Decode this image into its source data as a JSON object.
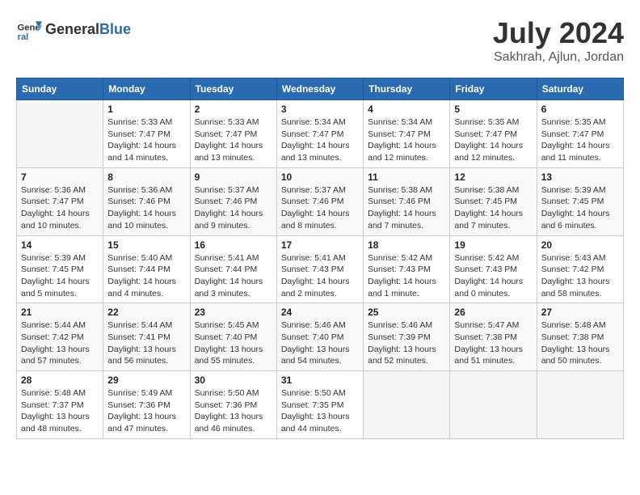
{
  "header": {
    "logo_general": "General",
    "logo_blue": "Blue",
    "month": "July 2024",
    "location": "Sakhrah, Ajlun, Jordan"
  },
  "weekdays": [
    "Sunday",
    "Monday",
    "Tuesday",
    "Wednesday",
    "Thursday",
    "Friday",
    "Saturday"
  ],
  "weeks": [
    [
      {
        "day": "",
        "info": ""
      },
      {
        "day": "1",
        "info": "Sunrise: 5:33 AM\nSunset: 7:47 PM\nDaylight: 14 hours\nand 14 minutes."
      },
      {
        "day": "2",
        "info": "Sunrise: 5:33 AM\nSunset: 7:47 PM\nDaylight: 14 hours\nand 13 minutes."
      },
      {
        "day": "3",
        "info": "Sunrise: 5:34 AM\nSunset: 7:47 PM\nDaylight: 14 hours\nand 13 minutes."
      },
      {
        "day": "4",
        "info": "Sunrise: 5:34 AM\nSunset: 7:47 PM\nDaylight: 14 hours\nand 12 minutes."
      },
      {
        "day": "5",
        "info": "Sunrise: 5:35 AM\nSunset: 7:47 PM\nDaylight: 14 hours\nand 12 minutes."
      },
      {
        "day": "6",
        "info": "Sunrise: 5:35 AM\nSunset: 7:47 PM\nDaylight: 14 hours\nand 11 minutes."
      }
    ],
    [
      {
        "day": "7",
        "info": "Sunrise: 5:36 AM\nSunset: 7:47 PM\nDaylight: 14 hours\nand 10 minutes."
      },
      {
        "day": "8",
        "info": "Sunrise: 5:36 AM\nSunset: 7:46 PM\nDaylight: 14 hours\nand 10 minutes."
      },
      {
        "day": "9",
        "info": "Sunrise: 5:37 AM\nSunset: 7:46 PM\nDaylight: 14 hours\nand 9 minutes."
      },
      {
        "day": "10",
        "info": "Sunrise: 5:37 AM\nSunset: 7:46 PM\nDaylight: 14 hours\nand 8 minutes."
      },
      {
        "day": "11",
        "info": "Sunrise: 5:38 AM\nSunset: 7:46 PM\nDaylight: 14 hours\nand 7 minutes."
      },
      {
        "day": "12",
        "info": "Sunrise: 5:38 AM\nSunset: 7:45 PM\nDaylight: 14 hours\nand 7 minutes."
      },
      {
        "day": "13",
        "info": "Sunrise: 5:39 AM\nSunset: 7:45 PM\nDaylight: 14 hours\nand 6 minutes."
      }
    ],
    [
      {
        "day": "14",
        "info": "Sunrise: 5:39 AM\nSunset: 7:45 PM\nDaylight: 14 hours\nand 5 minutes."
      },
      {
        "day": "15",
        "info": "Sunrise: 5:40 AM\nSunset: 7:44 PM\nDaylight: 14 hours\nand 4 minutes."
      },
      {
        "day": "16",
        "info": "Sunrise: 5:41 AM\nSunset: 7:44 PM\nDaylight: 14 hours\nand 3 minutes."
      },
      {
        "day": "17",
        "info": "Sunrise: 5:41 AM\nSunset: 7:43 PM\nDaylight: 14 hours\nand 2 minutes."
      },
      {
        "day": "18",
        "info": "Sunrise: 5:42 AM\nSunset: 7:43 PM\nDaylight: 14 hours\nand 1 minute."
      },
      {
        "day": "19",
        "info": "Sunrise: 5:42 AM\nSunset: 7:43 PM\nDaylight: 14 hours\nand 0 minutes."
      },
      {
        "day": "20",
        "info": "Sunrise: 5:43 AM\nSunset: 7:42 PM\nDaylight: 13 hours\nand 58 minutes."
      }
    ],
    [
      {
        "day": "21",
        "info": "Sunrise: 5:44 AM\nSunset: 7:42 PM\nDaylight: 13 hours\nand 57 minutes."
      },
      {
        "day": "22",
        "info": "Sunrise: 5:44 AM\nSunset: 7:41 PM\nDaylight: 13 hours\nand 56 minutes."
      },
      {
        "day": "23",
        "info": "Sunrise: 5:45 AM\nSunset: 7:40 PM\nDaylight: 13 hours\nand 55 minutes."
      },
      {
        "day": "24",
        "info": "Sunrise: 5:46 AM\nSunset: 7:40 PM\nDaylight: 13 hours\nand 54 minutes."
      },
      {
        "day": "25",
        "info": "Sunrise: 5:46 AM\nSunset: 7:39 PM\nDaylight: 13 hours\nand 52 minutes."
      },
      {
        "day": "26",
        "info": "Sunrise: 5:47 AM\nSunset: 7:38 PM\nDaylight: 13 hours\nand 51 minutes."
      },
      {
        "day": "27",
        "info": "Sunrise: 5:48 AM\nSunset: 7:38 PM\nDaylight: 13 hours\nand 50 minutes."
      }
    ],
    [
      {
        "day": "28",
        "info": "Sunrise: 5:48 AM\nSunset: 7:37 PM\nDaylight: 13 hours\nand 48 minutes."
      },
      {
        "day": "29",
        "info": "Sunrise: 5:49 AM\nSunset: 7:36 PM\nDaylight: 13 hours\nand 47 minutes."
      },
      {
        "day": "30",
        "info": "Sunrise: 5:50 AM\nSunset: 7:36 PM\nDaylight: 13 hours\nand 46 minutes."
      },
      {
        "day": "31",
        "info": "Sunrise: 5:50 AM\nSunset: 7:35 PM\nDaylight: 13 hours\nand 44 minutes."
      },
      {
        "day": "",
        "info": ""
      },
      {
        "day": "",
        "info": ""
      },
      {
        "day": "",
        "info": ""
      }
    ]
  ]
}
